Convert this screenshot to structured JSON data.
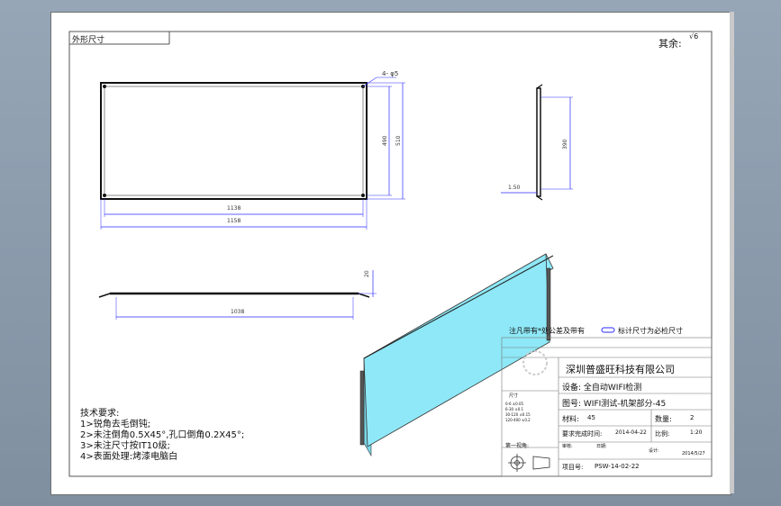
{
  "frame": {
    "label": "外形尺寸",
    "remaining_label": "其余:",
    "remaining_symbol": "√6"
  },
  "front_view": {
    "dim_width_inner": "1138",
    "dim_width_outer": "1158",
    "dim_height_inner": "490",
    "dim_height_outer": "510",
    "dim_hole": "4- φ5"
  },
  "side_view": {
    "dim_height": "390",
    "dim_thickness": "1.50"
  },
  "bottom_view": {
    "dim_length": "1038",
    "dim_height": "20"
  },
  "tech_requirements": {
    "title": "技术要求:",
    "items": [
      "1>锐角去毛倒钝;",
      "2>未注倒角0.5X45°,孔口倒角0.2X45°;",
      "3>未注尺寸按IT10级;",
      "4>表面处理:烤漆电脑白"
    ]
  },
  "notes": {
    "note_text": "注凡带有*处公差及带有",
    "note_text2": "标计尺寸为必检尺寸"
  },
  "title_block": {
    "company": "深圳普盛旺科技有限公司",
    "device": "设备: 全自动WIFI检测",
    "drawing_no": "图号: WIFI测试-机架部分-45",
    "material_label": "材料:",
    "material_value": "45",
    "qty_label": "数量:",
    "qty_value": "2",
    "required_date_label": "要求完成时间:",
    "required_date_value": "2014-04-22",
    "scale_label": "比例:",
    "scale_value": "1:20",
    "review_label": "审核:",
    "date_label": "日期:",
    "designer_label": "设计:",
    "designer_date": "2014/5/27",
    "project_label": "项目号:",
    "project_value": "PSW-14-02-22",
    "angle_label": "第一视角:",
    "tol_header": "尺寸",
    "tol_rows": [
      "0-6  ±0.05",
      "6-30 ±0.1",
      "30-120 ±0.15",
      "120-400 ±0.2"
    ]
  },
  "colors": {
    "line": "#111111",
    "dim_line": "#2a2aff",
    "glass": "#8ee8f7"
  }
}
